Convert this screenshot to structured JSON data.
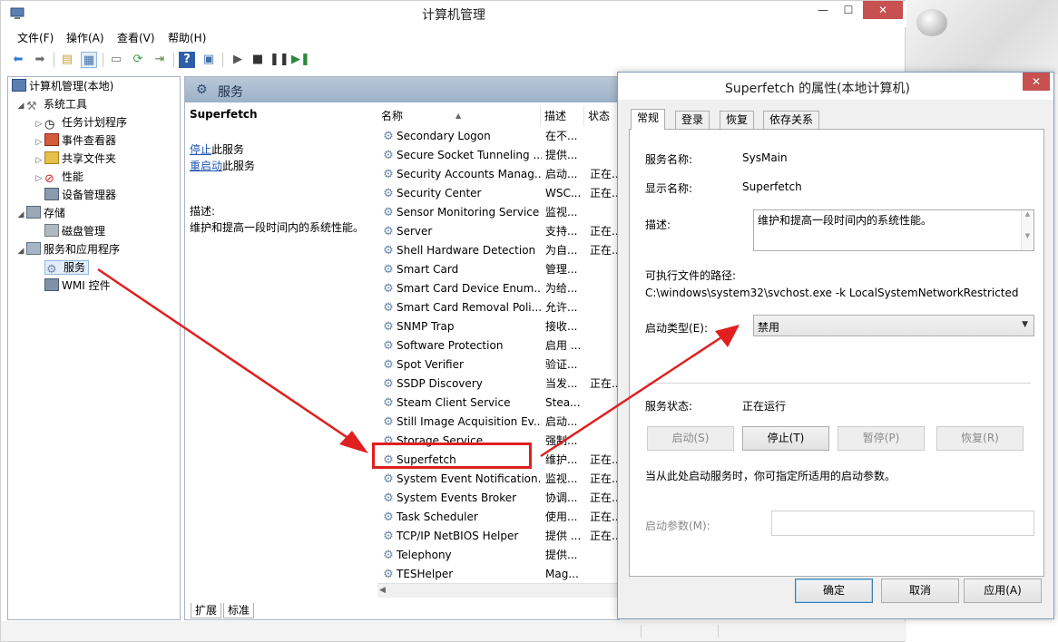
{
  "window": {
    "title": "计算机管理",
    "minimize": "—",
    "maximize": "☐",
    "close": "✕"
  },
  "menu": [
    "文件(F)",
    "操作(A)",
    "查看(V)",
    "帮助(H)"
  ],
  "tree": {
    "root": "计算机管理(本地)",
    "system_tools": "系统工具",
    "task_scheduler": "任务计划程序",
    "event_viewer": "事件查看器",
    "shared_folders": "共享文件夹",
    "performance": "性能",
    "device_manager": "设备管理器",
    "storage": "存储",
    "disk_management": "磁盘管理",
    "services_apps": "服务和应用程序",
    "services": "服务",
    "wmi": "WMI 控件"
  },
  "services_pane": {
    "header": "服务",
    "selected_name": "Superfetch",
    "stop_link": "停止",
    "stop_suffix": "此服务",
    "restart_link": "重启动",
    "restart_suffix": "此服务",
    "desc_label": "描述:",
    "desc_text": "维护和提高一段时间内的系统性能。",
    "columns": {
      "name": "名称",
      "desc": "描述",
      "state": "状态"
    },
    "rows": [
      {
        "name": "Secondary Logon",
        "desc": "在不...",
        "state": ""
      },
      {
        "name": "Secure Socket Tunneling ...",
        "desc": "提供...",
        "state": ""
      },
      {
        "name": "Security Accounts Manag...",
        "desc": "启动...",
        "state": "正在..."
      },
      {
        "name": "Security Center",
        "desc": "WSC...",
        "state": "正在..."
      },
      {
        "name": "Sensor Monitoring Service",
        "desc": "监视...",
        "state": ""
      },
      {
        "name": "Server",
        "desc": "支持...",
        "state": "正在..."
      },
      {
        "name": "Shell Hardware Detection",
        "desc": "为自...",
        "state": "正在..."
      },
      {
        "name": "Smart Card",
        "desc": "管理...",
        "state": ""
      },
      {
        "name": "Smart Card Device Enum...",
        "desc": "为给...",
        "state": ""
      },
      {
        "name": "Smart Card Removal Poli...",
        "desc": "允许...",
        "state": ""
      },
      {
        "name": "SNMP Trap",
        "desc": "接收...",
        "state": ""
      },
      {
        "name": "Software Protection",
        "desc": "启用 ...",
        "state": ""
      },
      {
        "name": "Spot Verifier",
        "desc": "验证...",
        "state": ""
      },
      {
        "name": "SSDP Discovery",
        "desc": "当发...",
        "state": "正在..."
      },
      {
        "name": "Steam Client Service",
        "desc": "Stea...",
        "state": ""
      },
      {
        "name": "Still Image Acquisition Ev...",
        "desc": "启动...",
        "state": ""
      },
      {
        "name": "Storage Service",
        "desc": "强制...",
        "state": ""
      },
      {
        "name": "Superfetch",
        "desc": "维护...",
        "state": "正在..."
      },
      {
        "name": "System Event Notification...",
        "desc": "监视...",
        "state": "正在..."
      },
      {
        "name": "System Events Broker",
        "desc": "协调...",
        "state": "正在..."
      },
      {
        "name": "Task Scheduler",
        "desc": "使用...",
        "state": "正在..."
      },
      {
        "name": "TCP/IP NetBIOS Helper",
        "desc": "提供 ...",
        "state": "正在..."
      },
      {
        "name": "Telephony",
        "desc": "提供...",
        "state": ""
      },
      {
        "name": "TESHelper",
        "desc": "Mag...",
        "state": ""
      }
    ],
    "tab_extended": "扩展",
    "tab_standard": "标准"
  },
  "dialog": {
    "title": "Superfetch 的属性(本地计算机)",
    "close": "✕",
    "tabs": [
      "常规",
      "登录",
      "恢复",
      "依存关系"
    ],
    "service_name_label": "服务名称:",
    "service_name": "SysMain",
    "display_name_label": "显示名称:",
    "display_name": "Superfetch",
    "desc_label": "描述:",
    "desc": "维护和提高一段时间内的系统性能。",
    "exe_path_label": "可执行文件的路径:",
    "exe_path": "C:\\windows\\system32\\svchost.exe -k LocalSystemNetworkRestricted",
    "startup_type_label": "启动类型(E):",
    "startup_type": "禁用",
    "status_label": "服务状态:",
    "status": "正在运行",
    "btn_start": "启动(S)",
    "btn_stop": "停止(T)",
    "btn_pause": "暂停(P)",
    "btn_resume": "恢复(R)",
    "hint": "当从此处启动服务时，你可指定所适用的启动参数。",
    "param_label": "启动参数(M):",
    "ok": "确定",
    "cancel": "取消",
    "apply": "应用(A)"
  },
  "colors": {
    "accent_red": "#e01f1f",
    "link_blue": "#1a55b8",
    "header_blue": "#9cb1c7"
  }
}
